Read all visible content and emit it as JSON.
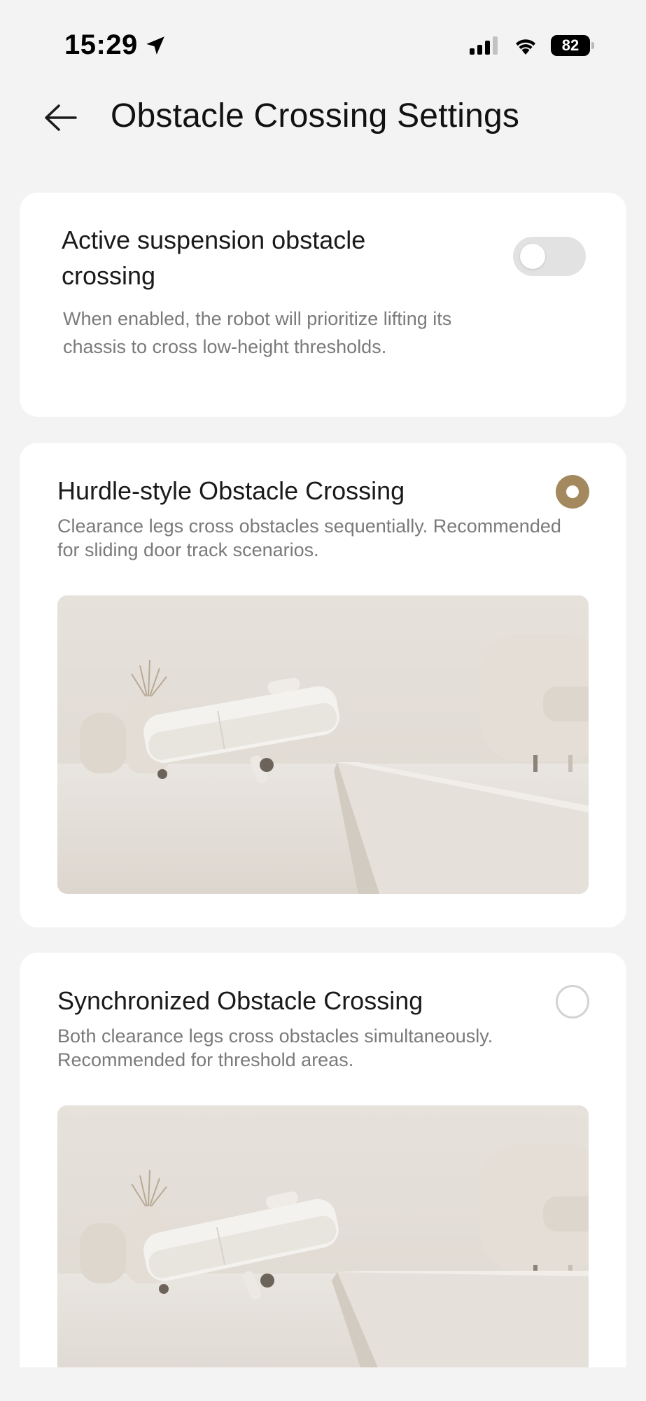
{
  "status_bar": {
    "time": "15:29",
    "battery": "82",
    "icons": [
      "location-arrow-icon",
      "cellular-signal-icon",
      "wifi-icon",
      "battery-icon"
    ]
  },
  "header": {
    "title": "Obstacle Crossing Settings",
    "back_icon": "arrow-left-icon"
  },
  "active_suspension": {
    "title": "Active suspension obstacle crossing",
    "description": "When enabled, the robot will prioritize lifting its chassis to cross low-height thresholds.",
    "enabled": false
  },
  "options": [
    {
      "title": "Hurdle-style Obstacle Crossing",
      "description": "Clearance legs cross obstacles sequentially. Recommended for sliding door track scenarios.",
      "selected": true
    },
    {
      "title": "Synchronized Obstacle Crossing",
      "description": "Both clearance legs cross obstacles simultaneously. Recommended for threshold areas.",
      "selected": false
    }
  ],
  "colors": {
    "accent": "#a4895f",
    "background": "#f3f3f3",
    "card": "#ffffff",
    "secondary_text": "#7a7a7a"
  }
}
